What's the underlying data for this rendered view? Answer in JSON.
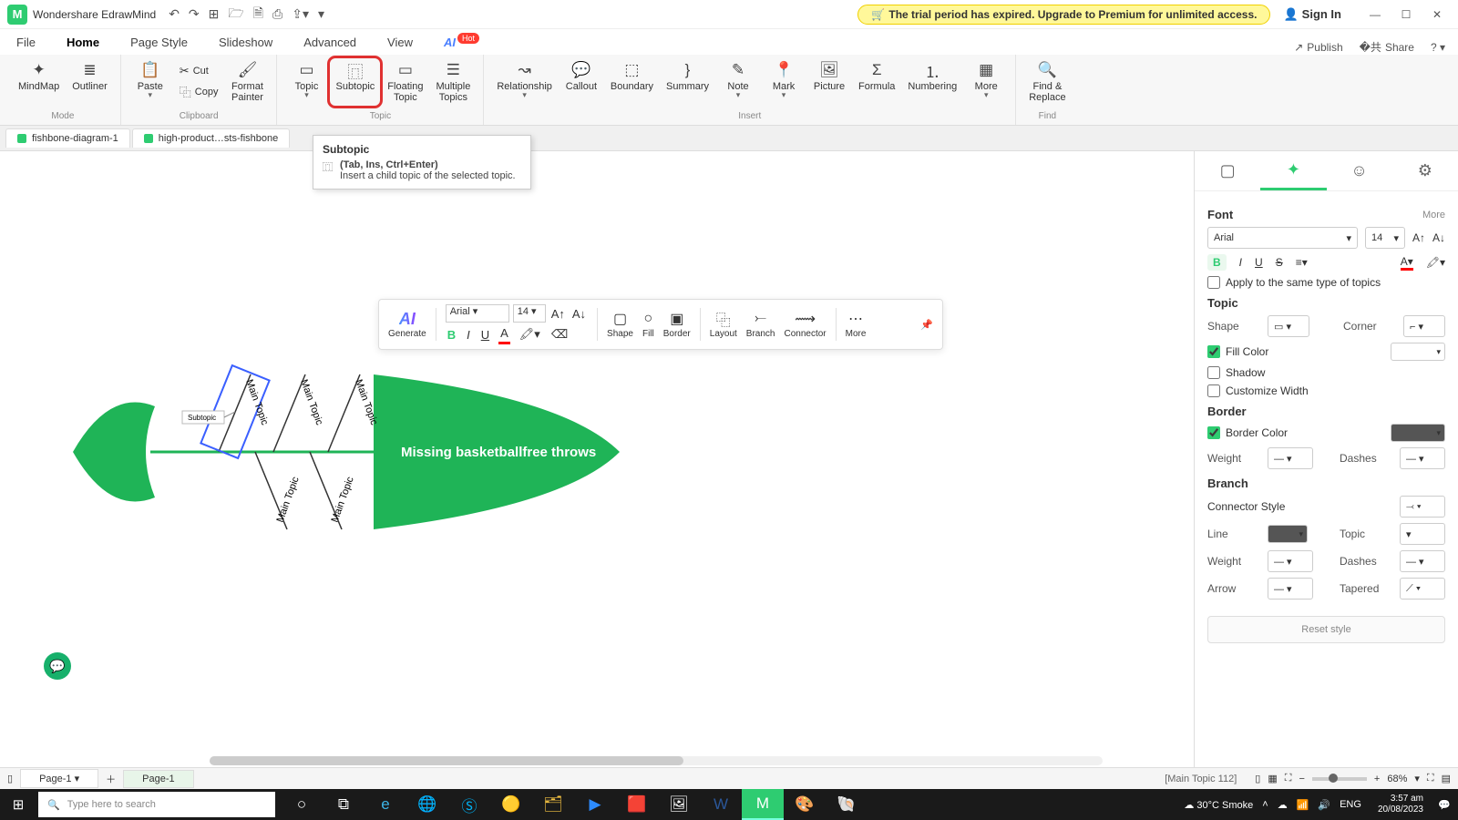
{
  "app": {
    "title": "Wondershare EdrawMind"
  },
  "trial": {
    "text": "The trial period has expired. Upgrade to Premium for unlimited access."
  },
  "signin": "Sign In",
  "menubar": {
    "file": "File",
    "home": "Home",
    "page_style": "Page Style",
    "slideshow": "Slideshow",
    "advanced": "Advanced",
    "view": "View",
    "ai": "AI",
    "ai_badge": "Hot",
    "publish": "Publish",
    "share": "Share"
  },
  "ribbon": {
    "mode": {
      "mindmap": "MindMap",
      "outliner": "Outliner",
      "label": "Mode"
    },
    "clipboard": {
      "paste": "Paste",
      "cut": "Cut",
      "copy": "Copy",
      "format_painter": "Format\nPainter",
      "label": "Clipboard"
    },
    "topic": {
      "topic": "Topic",
      "subtopic": "Subtopic",
      "floating": "Floating\nTopic",
      "multiple": "Multiple\nTopics",
      "label": "Topic"
    },
    "insert": {
      "relationship": "Relationship",
      "callout": "Callout",
      "boundary": "Boundary",
      "summary": "Summary",
      "note": "Note",
      "mark": "Mark",
      "picture": "Picture",
      "formula": "Formula",
      "numbering": "Numbering",
      "more": "More",
      "label": "Insert"
    },
    "find": {
      "find": "Find &\nReplace",
      "label": "Find"
    }
  },
  "tooltip": {
    "title": "Subtopic",
    "shortcut": "(Tab, Ins, Ctrl+Enter)",
    "desc": "Insert a child topic of the selected topic."
  },
  "doctabs": {
    "t1": "fishbone-diagram-1",
    "t2": "high-product…sts-fishbone"
  },
  "floating": {
    "generate": "Generate",
    "font": "Arial",
    "size": "14",
    "shape": "Shape",
    "fill": "Fill",
    "border": "Border",
    "layout": "Layout",
    "branch": "Branch",
    "connector": "Connector",
    "more": "More"
  },
  "diagram": {
    "central": "Missing basketballfree throws",
    "bones": [
      "Main Topic",
      "Main Topic",
      "Main Topic",
      "Main Topic",
      "Main Topic"
    ],
    "subtopic": "Subtopic"
  },
  "sidepanel": {
    "font": {
      "title": "Font",
      "more": "More",
      "family": "Arial",
      "size": "14",
      "apply": "Apply to the same type of topics"
    },
    "topic": {
      "title": "Topic",
      "shape": "Shape",
      "corner": "Corner",
      "fillcolor": "Fill Color",
      "shadow": "Shadow",
      "customize": "Customize Width"
    },
    "border": {
      "title": "Border",
      "bordercolor": "Border Color",
      "weight": "Weight",
      "dashes": "Dashes"
    },
    "branch": {
      "title": "Branch",
      "connector": "Connector Style",
      "line": "Line",
      "topic": "Topic",
      "weight": "Weight",
      "dashes": "Dashes",
      "arrow": "Arrow",
      "tapered": "Tapered"
    },
    "reset": "Reset style"
  },
  "pagetabs": {
    "p1": "Page-1",
    "p2": "Page-1",
    "status": "[Main Topic 112]",
    "zoom": "68%"
  },
  "taskbar": {
    "search": "Type here to search",
    "weather": "30°C  Smoke",
    "time": "3:57 am",
    "date": "20/08/2023"
  }
}
